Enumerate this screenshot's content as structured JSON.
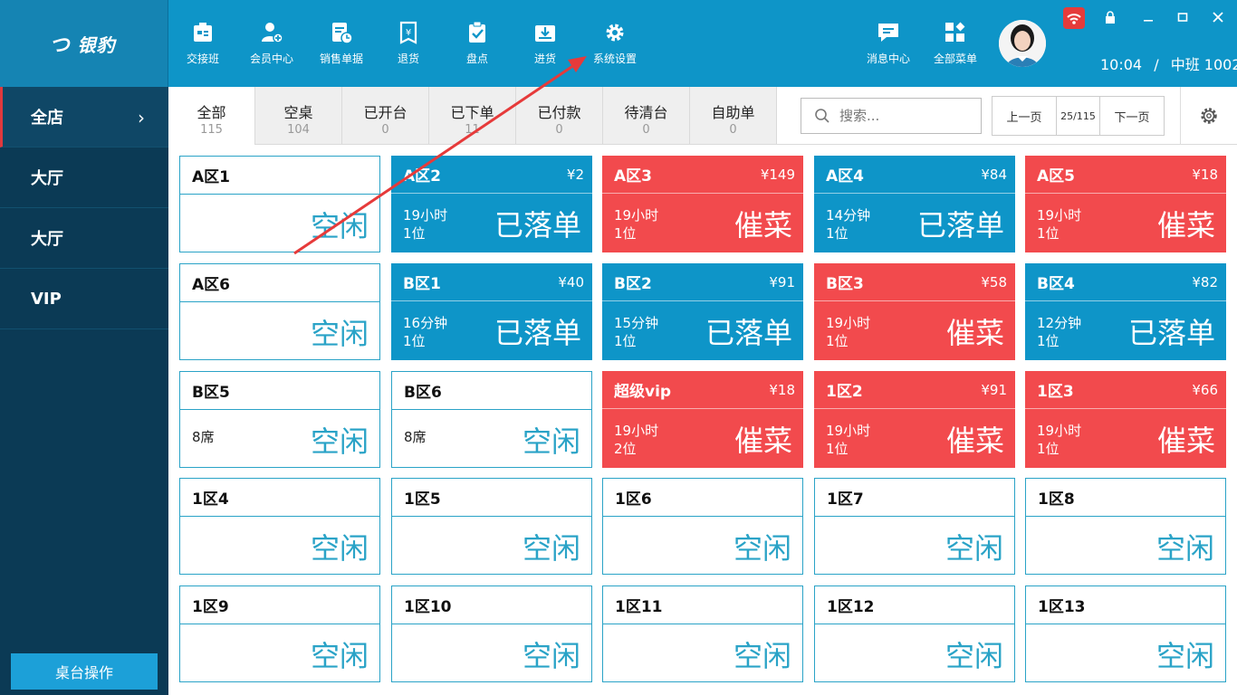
{
  "app": {
    "logo_text": "银豹",
    "logo_mark": "つ"
  },
  "toolbar": {
    "items": [
      {
        "label": "交接班",
        "icon": "handover-icon"
      },
      {
        "label": "会员中心",
        "icon": "member-icon"
      },
      {
        "label": "销售单据",
        "icon": "sales-receipt-icon"
      },
      {
        "label": "退货",
        "icon": "return-icon"
      },
      {
        "label": "盘点",
        "icon": "inventory-check-icon"
      },
      {
        "label": "进货",
        "icon": "purchase-icon"
      },
      {
        "label": "系统设置",
        "icon": "gear-icon"
      }
    ],
    "right_items": [
      {
        "label": "消息中心",
        "icon": "message-icon"
      },
      {
        "label": "全部菜单",
        "icon": "all-menu-icon"
      }
    ],
    "time": "10:04",
    "separator": "/",
    "shift": "中班 1002"
  },
  "sidebar": {
    "items": [
      {
        "label": "全店",
        "active": true
      },
      {
        "label": "大厅",
        "active": false
      },
      {
        "label": "大厅",
        "active": false
      },
      {
        "label": "VIP",
        "active": false
      }
    ],
    "operation_button": "桌台操作"
  },
  "tabs": [
    {
      "label": "全部",
      "count": "115",
      "active": true
    },
    {
      "label": "空桌",
      "count": "104"
    },
    {
      "label": "已开台",
      "count": "0"
    },
    {
      "label": "已下单",
      "count": "11"
    },
    {
      "label": "已付款",
      "count": "0"
    },
    {
      "label": "待清台",
      "count": "0"
    },
    {
      "label": "自助单",
      "count": "0"
    }
  ],
  "search": {
    "placeholder": "搜索..."
  },
  "pager": {
    "prev": "上一页",
    "page": "25/115",
    "next": "下一页"
  },
  "colors": {
    "ordered": "#0e95c8",
    "urge": "#f24a4d",
    "idle_border": "#2aa3c7",
    "topbar": "#0e95c8",
    "sidebar": "#0b3a55"
  },
  "tables": [
    {
      "name": "A区1",
      "state": "idle",
      "status": "空闲"
    },
    {
      "name": "A区2",
      "state": "ordered",
      "price": "¥2",
      "time": "19小时",
      "guests": "1位",
      "status": "已落单"
    },
    {
      "name": "A区3",
      "state": "urge",
      "price": "¥149",
      "time": "19小时",
      "guests": "1位",
      "status": "催菜"
    },
    {
      "name": "A区4",
      "state": "ordered",
      "price": "¥84",
      "time": "14分钟",
      "guests": "1位",
      "status": "已落单"
    },
    {
      "name": "A区5",
      "state": "urge",
      "price": "¥18",
      "time": "19小时",
      "guests": "1位",
      "status": "催菜"
    },
    {
      "name": "A区6",
      "state": "idle",
      "status": "空闲"
    },
    {
      "name": "B区1",
      "state": "ordered",
      "price": "¥40",
      "time": "16分钟",
      "guests": "1位",
      "status": "已落单"
    },
    {
      "name": "B区2",
      "state": "ordered",
      "price": "¥91",
      "time": "15分钟",
      "guests": "1位",
      "status": "已落单"
    },
    {
      "name": "B区3",
      "state": "urge",
      "price": "¥58",
      "time": "19小时",
      "guests": "1位",
      "status": "催菜"
    },
    {
      "name": "B区4",
      "state": "ordered",
      "price": "¥82",
      "time": "12分钟",
      "guests": "1位",
      "status": "已落单"
    },
    {
      "name": "B区5",
      "state": "idle",
      "seats": "8席",
      "status": "空闲"
    },
    {
      "name": "B区6",
      "state": "idle",
      "seats": "8席",
      "status": "空闲"
    },
    {
      "name": "超级vip",
      "state": "urge",
      "price": "¥18",
      "time": "19小时",
      "guests": "2位",
      "status": "催菜"
    },
    {
      "name": "1区2",
      "state": "urge",
      "price": "¥91",
      "time": "19小时",
      "guests": "1位",
      "status": "催菜"
    },
    {
      "name": "1区3",
      "state": "urge",
      "price": "¥66",
      "time": "19小时",
      "guests": "1位",
      "status": "催菜"
    },
    {
      "name": "1区4",
      "state": "idle",
      "status": "空闲"
    },
    {
      "name": "1区5",
      "state": "idle",
      "status": "空闲"
    },
    {
      "name": "1区6",
      "state": "idle",
      "status": "空闲"
    },
    {
      "name": "1区7",
      "state": "idle",
      "status": "空闲"
    },
    {
      "name": "1区8",
      "state": "idle",
      "status": "空闲"
    },
    {
      "name": "1区9",
      "state": "idle",
      "status": "空闲"
    },
    {
      "name": "1区10",
      "state": "idle",
      "status": "空闲"
    },
    {
      "name": "1区11",
      "state": "idle",
      "status": "空闲"
    },
    {
      "name": "1区12",
      "state": "idle",
      "status": "空闲"
    },
    {
      "name": "1区13",
      "state": "idle",
      "status": "空闲"
    }
  ]
}
